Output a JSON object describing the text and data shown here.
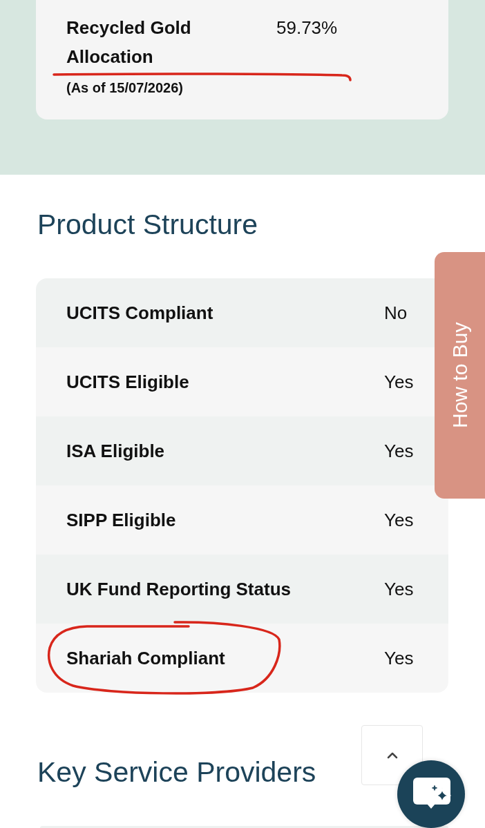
{
  "allocation_card": {
    "label": "Recycled Gold Allocation",
    "value": "59.73%",
    "date": "(As of 15/07/2026)",
    "underlined": true
  },
  "product_structure": {
    "title": "Product Structure",
    "rows": [
      {
        "label": "UCITS Compliant",
        "value": "No",
        "circled": false
      },
      {
        "label": "UCITS Eligible",
        "value": "Yes",
        "circled": false
      },
      {
        "label": "ISA Eligible",
        "value": "Yes",
        "circled": false
      },
      {
        "label": "SIPP Eligible",
        "value": "Yes",
        "circled": false
      },
      {
        "label": "UK Fund Reporting Status",
        "value": "Yes",
        "circled": false
      },
      {
        "label": "Shariah Compliant",
        "value": "Yes",
        "circled": true
      }
    ]
  },
  "how_to_buy": {
    "label": "How to Buy"
  },
  "key_service_providers": {
    "title": "Key Service Providers"
  }
}
